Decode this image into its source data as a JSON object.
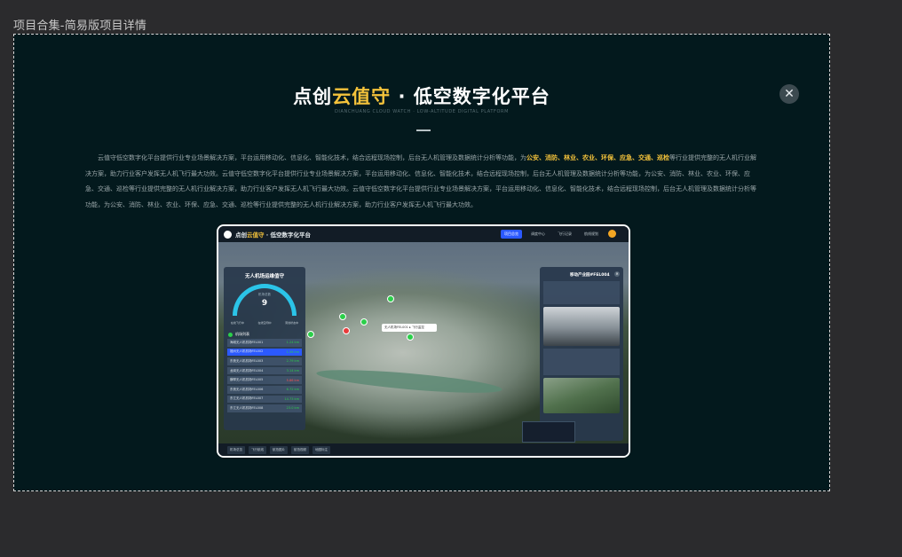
{
  "frame": {
    "label": "项目合集-简易版项目详情"
  },
  "close_icon": "close-icon",
  "header": {
    "title_prefix": "点创",
    "title_highlight": "云值守",
    "title_suffix": " · 低空数字化平台",
    "subtitle": "DIANCHUANG CLOUD WATCH · LOW-ALTITUDE DIGITAL PLATFORM"
  },
  "description": {
    "part1": "云值守低空数字化平台提供行业专业场景解决方案，平台运用移动化、信息化、智能化技术，结合远程现场控制，后台无人机管理及数据统计分析等功能，为",
    "highlight": "公安、消防、林业、农业、环保、应急、交通、巡检",
    "part2": "等行业提供完整的无人机行业解决方案，助力行业客户发挥无人机飞行最大功效。云值守低空数字化平台提供行业专业场景解决方案，平台运用移动化、信息化、智能化技术，结合远程现场控制，后台无人机管理及数据统计分析等功能，为公安、消防、林业、农业、环保、应急、交通、巡检等行业提供完整的无人机行业解决方案，助力行业客户发挥无人机飞行最大功效。云值守低空数字化平台提供行业专业场景解决方案，平台运用移动化、信息化、智能化技术，结合远程现场控制，后台无人机管理及数据统计分析等功能，为公安、消防、林业、农业、环保、应急、交通、巡检等行业提供完整的无人机行业解决方案，助力行业客户发挥无人机飞行最大功效。"
  },
  "screenshot": {
    "app_title_prefix": "点创",
    "app_title_highlight": "云值守",
    "app_title_suffix": " · 低空数字化平台",
    "nav": [
      "项目总览",
      "调度中心",
      "飞行记录",
      "航线规划"
    ],
    "left_panel": {
      "title": "无人机场运维值守",
      "gauge_caption": "机场总数",
      "gauge_value": "9",
      "gauge_unit": "单位/台",
      "legend": [
        "在线飞行中",
        "在线空闲中",
        "离线状态中"
      ],
      "list_title": "机场列表",
      "rows": [
        {
          "name": "海城无人机机场FEL001",
          "value": "1.24 km",
          "active": false,
          "alert": false
        },
        {
          "name": "福州无人机机场FEL002",
          "value": "1.56 km",
          "active": true,
          "alert": false
        },
        {
          "name": "东莞无人机机场FEL003",
          "value": "2.79 km",
          "active": false,
          "alert": false
        },
        {
          "name": "龙岗无人机机场FEL004",
          "value": "3.14 km",
          "active": false,
          "alert": false
        },
        {
          "name": "横琴无人机机场FEL005",
          "value": "5.86 km",
          "active": false,
          "alert": true
        },
        {
          "name": "东莞无人机机场FEL006",
          "value": "6.72 km",
          "active": false,
          "alert": false
        },
        {
          "name": "东江无人机机场FEL007",
          "value": "14.73 km",
          "active": false,
          "alert": false
        },
        {
          "name": "东江无人机机场FEL008",
          "value": "23.0 km",
          "active": false,
          "alert": false
        }
      ]
    },
    "right_panel": {
      "title": "移动产业园#FEL004"
    },
    "callout": "无人机场FEL001 ▸ 飞行监控",
    "bottom_tabs": [
      "机场总览",
      "飞行航线",
      "航拍图片",
      "航拍视频",
      "地图标注"
    ]
  }
}
